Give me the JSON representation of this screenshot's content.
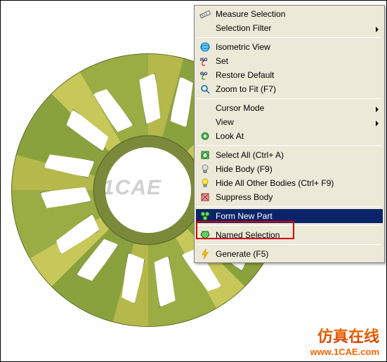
{
  "menu": {
    "measure_selection": "Measure Selection",
    "selection_filter": "Selection Filter",
    "isometric_view": "Isometric View",
    "set": "Set",
    "restore_default": "Restore Default",
    "zoom_to_fit": "Zoom to Fit (F7)",
    "cursor_mode": "Cursor Mode",
    "view": "View",
    "look_at": "Look At",
    "select_all": "Select All (Ctrl+ A)",
    "hide_body": "Hide Body (F9)",
    "hide_all_other": "Hide All Other Bodies (Ctrl+ F9)",
    "suppress_body": "Suppress Body",
    "form_new_part": "Form New Part",
    "named_selection": "Named Selection",
    "generate": "Generate (F5)"
  },
  "watermark": {
    "center": "1CAE",
    "brand_cn": "仿真在线",
    "brand_url": "www.1CAE.com"
  }
}
